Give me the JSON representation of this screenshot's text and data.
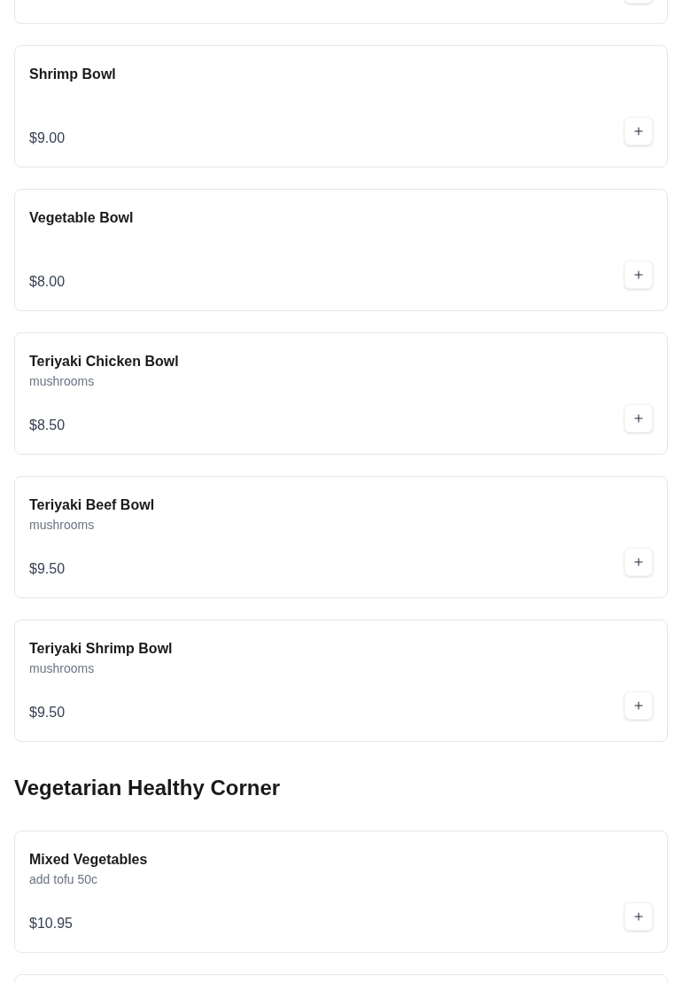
{
  "sections": [
    {
      "items": [
        {
          "name": "Shrimp Bowl",
          "price": "$9.00"
        },
        {
          "name": "Vegetable Bowl",
          "price": "$8.00"
        },
        {
          "name": "Teriyaki Chicken Bowl",
          "description": "mushrooms",
          "price": "$8.50"
        },
        {
          "name": "Teriyaki Beef Bowl",
          "description": "mushrooms",
          "price": "$9.50"
        },
        {
          "name": "Teriyaki Shrimp Bowl",
          "description": "mushrooms",
          "price": "$9.50"
        }
      ]
    },
    {
      "heading": "Vegetarian Healthy Corner",
      "items": [
        {
          "name": "Mixed Vegetables",
          "description": "add tofu 50c",
          "price": "$10.95"
        }
      ]
    }
  ]
}
